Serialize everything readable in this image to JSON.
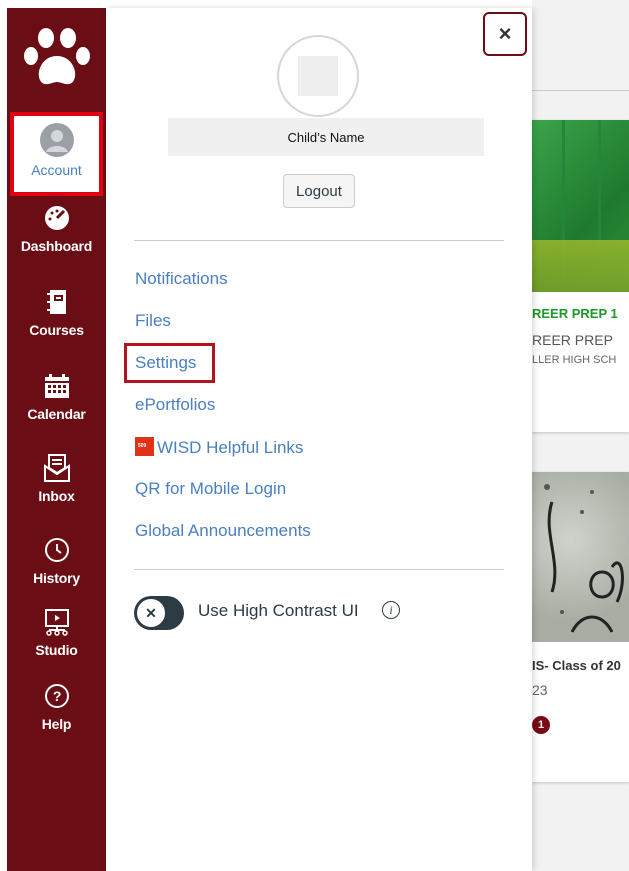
{
  "nav": {
    "account_label": "Account",
    "items": [
      {
        "label": "Dashboard",
        "icon": "dashboard-icon"
      },
      {
        "label": "Courses",
        "icon": "courses-icon"
      },
      {
        "label": "Calendar",
        "icon": "calendar-icon"
      },
      {
        "label": "Inbox",
        "icon": "inbox-icon"
      },
      {
        "label": "History",
        "icon": "history-icon"
      },
      {
        "label": "Studio",
        "icon": "studio-icon"
      },
      {
        "label": "Help",
        "icon": "help-icon"
      }
    ],
    "background_color": "#6b0d14",
    "highlight_color": "#e00012"
  },
  "tray": {
    "close_label": "×",
    "user_name": "Child’s Name",
    "logout_label": "Logout",
    "links": [
      {
        "label": "Notifications"
      },
      {
        "label": "Files"
      },
      {
        "label": "Settings"
      },
      {
        "label": "ePortfolios"
      },
      {
        "label": "WISD Helpful Links",
        "icon": "wisd-link-icon"
      },
      {
        "label": "QR for Mobile Login"
      },
      {
        "label": "Global Announcements"
      }
    ],
    "high_contrast_label": "Use High Contrast UI",
    "high_contrast_enabled": false,
    "link_color": "#4a7fc0"
  },
  "background_cards": [
    {
      "title": "REER PREP 1",
      "subtitle": "REER PREP",
      "school": "LLER HIGH SCH"
    },
    {
      "title": "IS- Class of 20",
      "subtitle": "23",
      "badge": "1"
    }
  ]
}
